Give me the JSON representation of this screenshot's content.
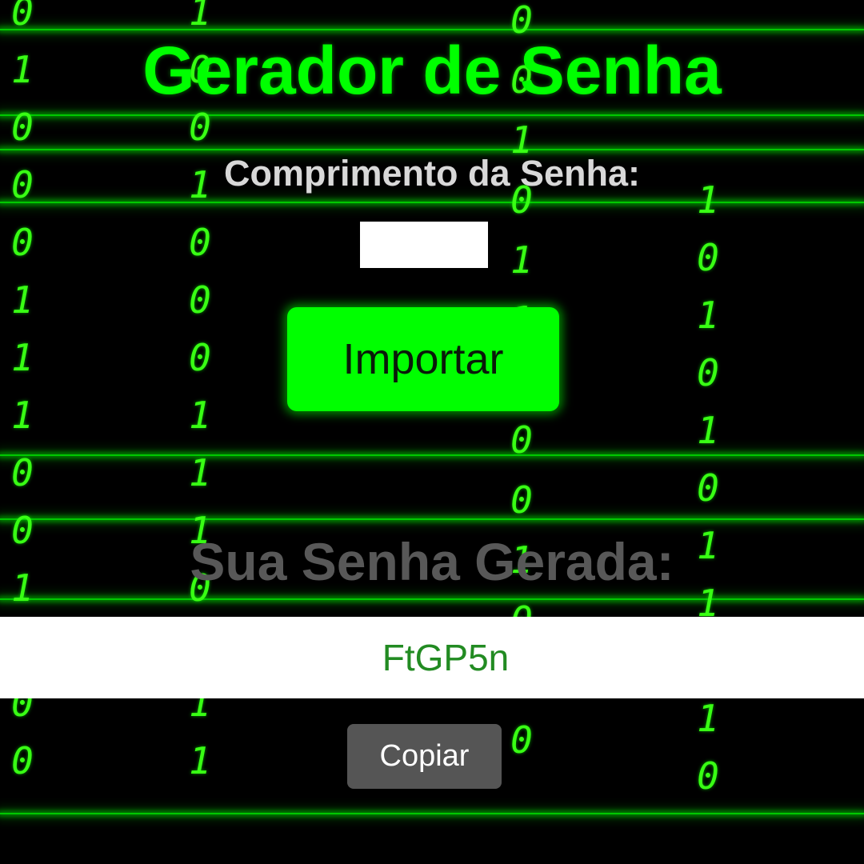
{
  "app": {
    "title": "Gerador de Senha",
    "length_label": "Comprimento da Senha:",
    "length_value": "",
    "generate_button": "Importar",
    "result_label": "Sua Senha Gerada:",
    "generated_password": "FtGP5n",
    "copy_button": "Copiar"
  },
  "background": {
    "effect": "binary-rain",
    "columns": [
      {
        "digits": [
          "0",
          "1",
          "0",
          "0",
          "0",
          "1",
          "1",
          "1",
          "0",
          "0",
          "1",
          "1",
          "0",
          "0"
        ]
      },
      {
        "digits": [
          "1",
          "0",
          "0",
          "1",
          "0",
          "0",
          "0",
          "1",
          "1",
          "1",
          "0",
          "1",
          "1",
          "1"
        ]
      },
      {
        "digits": [
          "0",
          "0",
          "1",
          "0",
          "1",
          "1",
          "1",
          "0",
          "0",
          "1",
          "0",
          "1",
          "0"
        ]
      },
      {
        "digits": [
          "1",
          "0",
          "1",
          "0",
          "1",
          "0",
          "1",
          "1",
          "0",
          "1",
          "0"
        ]
      }
    ]
  },
  "colors": {
    "background": "#000000",
    "accent_green": "#00ff00",
    "digit_green": "#39ff14",
    "password_text": "#228b22",
    "copy_button_bg": "#555555",
    "result_label": "#585858"
  }
}
